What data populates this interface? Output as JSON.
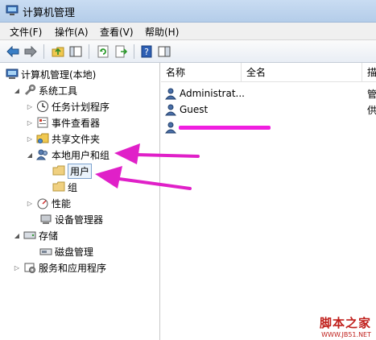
{
  "window": {
    "title": "计算机管理"
  },
  "menu": [
    {
      "label": "文件(F)"
    },
    {
      "label": "操作(A)"
    },
    {
      "label": "查看(V)"
    },
    {
      "label": "帮助(H)"
    }
  ],
  "toolbar": {
    "icons": [
      "back-arrow-icon",
      "forward-arrow-icon",
      "up-folder-icon",
      "show-hide-tree-icon",
      "refresh-icon",
      "export-list-icon",
      "help-icon",
      "view-pane-icon"
    ]
  },
  "tree": {
    "root": "计算机管理(本地)",
    "system_tools": "系统工具",
    "task_scheduler": "任务计划程序",
    "event_viewer": "事件查看器",
    "shared_folders": "共享文件夹",
    "local_users_groups": "本地用户和组",
    "users": "用户",
    "groups": "组",
    "performance": "性能",
    "device_manager": "设备管理器",
    "storage": "存储",
    "disk_management": "磁盘管理",
    "services_apps": "服务和应用程序"
  },
  "list": {
    "columns": [
      "名称",
      "全名",
      "描"
    ],
    "rows": [
      {
        "name": "Administrat...",
        "fullname": "",
        "desc": "管"
      },
      {
        "name": "Guest",
        "fullname": "",
        "desc": "供"
      },
      {
        "name": "",
        "fullname": "",
        "desc": ""
      }
    ]
  },
  "watermark": {
    "main": "脚本之家",
    "sub": "WWW.JB51.NET"
  },
  "colors": {
    "annotation_arrow": "#e020c8",
    "redaction": "#f01ee0",
    "watermark": "#c0201c"
  }
}
